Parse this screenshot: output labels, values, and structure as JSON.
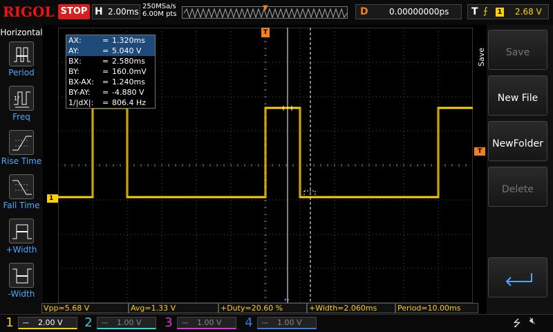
{
  "topbar": {
    "logo": "RIGOL",
    "run_state": "STOP",
    "horizontal": {
      "key": "H",
      "value": "2.00ms"
    },
    "sample_rate": "250MSa/s",
    "memory_depth": "6.00M pts",
    "delay": {
      "key": "D",
      "value": "0.00000000ps"
    },
    "trigger": {
      "key": "T",
      "source": "1",
      "level": "2.68 V"
    }
  },
  "left_panel": {
    "title": "Horizontal",
    "items": [
      {
        "label": "Period"
      },
      {
        "label": "Freq"
      },
      {
        "label": "Rise Time"
      },
      {
        "label": "Fall Time"
      },
      {
        "label": "+Width"
      },
      {
        "label": "-Width"
      }
    ]
  },
  "cursor_table": [
    {
      "key": "AX:",
      "eq": "=",
      "value": "1.320ms",
      "highlight": true
    },
    {
      "key": "AY:",
      "eq": "=",
      "value": "5.040 V",
      "highlight": true
    },
    {
      "key": "BX:",
      "eq": "=",
      "value": "2.580ms",
      "highlight": false
    },
    {
      "key": "BY:",
      "eq": "=",
      "value": "160.0mV",
      "highlight": false
    },
    {
      "key": "BX-AX:",
      "eq": "=",
      "value": "1.240ms",
      "highlight": false
    },
    {
      "key": "BY-AY:",
      "eq": "=",
      "value": "-4.880 V",
      "highlight": false
    },
    {
      "key": "1/|dX|:",
      "eq": "=",
      "value": "806.4 Hz",
      "highlight": false
    }
  ],
  "measurements": [
    "Vpp=5.68 V",
    "Avg=1.33 V",
    "+Duty=20.60 %",
    "+Width=2.060ms",
    "Period=10.00ms"
  ],
  "channels": [
    {
      "num": "1",
      "scale": "2.00 V",
      "active": true,
      "color": "#ffd000"
    },
    {
      "num": "2",
      "scale": "1.00 V",
      "active": false,
      "color": "#2ad6d6"
    },
    {
      "num": "3",
      "scale": "1.00 V",
      "active": false,
      "color": "#d43ad4"
    },
    {
      "num": "4",
      "scale": "1.00 V",
      "active": false,
      "color": "#3a7ad4"
    }
  ],
  "right_panel": {
    "title": "Save",
    "buttons": [
      {
        "label": "Save",
        "enabled": false
      },
      {
        "label": "New File",
        "enabled": true
      },
      {
        "label": "NewFolder",
        "enabled": true
      },
      {
        "label": "Delete",
        "enabled": false
      }
    ]
  },
  "markers": {
    "ch1_ground": "1",
    "trigger_pos": "T"
  },
  "waveform": {
    "color": "#ffd000",
    "high_level": "5.04 V",
    "low_level": "160.0mV",
    "period": "10.00ms",
    "positive_width": "2.060ms"
  },
  "colors": {
    "accent": "#ffd000",
    "trigger_marker": "#f08020",
    "brand": "#e11111",
    "highlight": "#1e4a7a"
  }
}
